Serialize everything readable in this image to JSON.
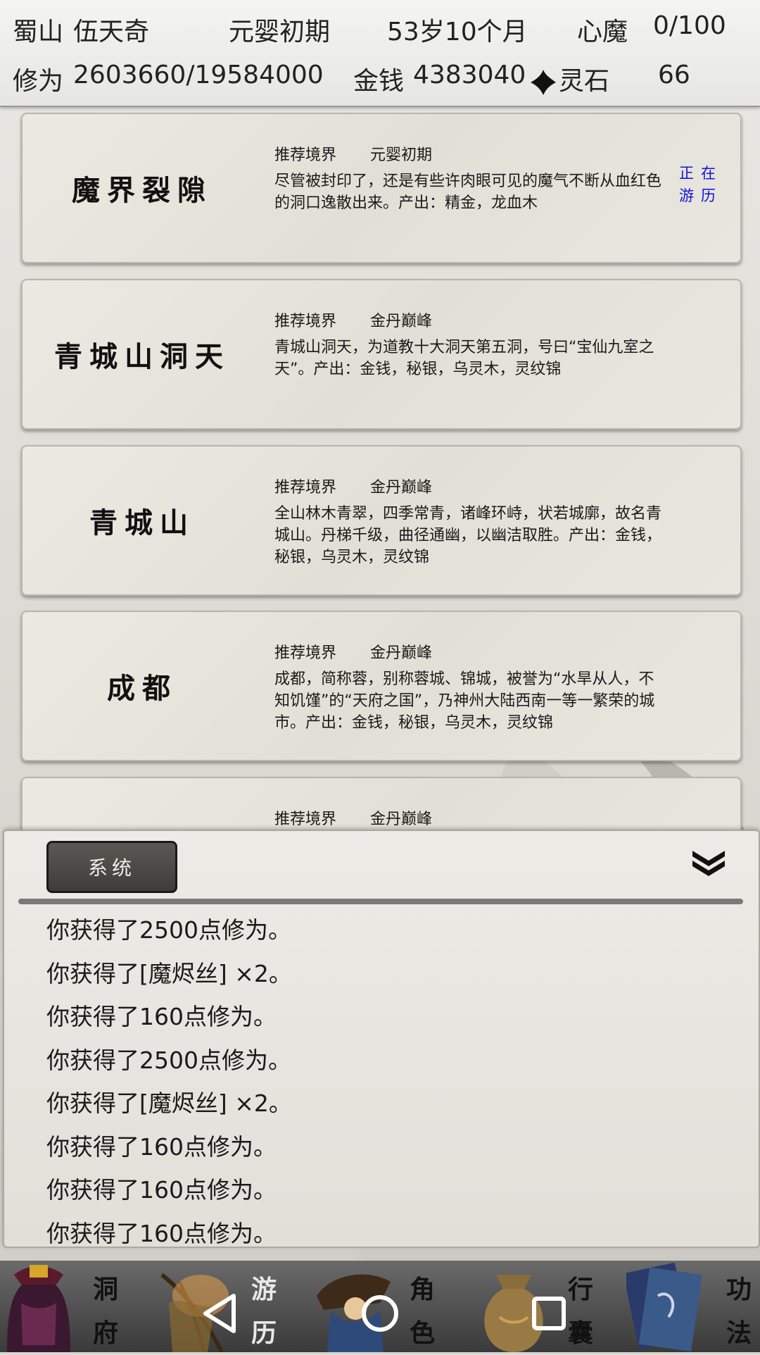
{
  "header": {
    "location": "蜀山",
    "character_name": "伍天奇",
    "realm": "元婴初期",
    "age": "53岁10个月",
    "demon_label": "心魔",
    "demon_value": "0/100",
    "cultivation_label": "修为",
    "cultivation_value": "2603660/19584000",
    "money_label": "金钱",
    "money_value": "4383040",
    "spirit_stone_label": "灵石",
    "spirit_stone_value": "66"
  },
  "locations": [
    {
      "name": "魔界裂隙",
      "realm_label": "推荐境界",
      "realm_value": "元婴初期",
      "description": "尽管被封印了，还是有些许肉眼可见的魔气不断从血红色的洞口逸散出来。产出：精金，龙血木",
      "status": "正在游历"
    },
    {
      "name": "青城山洞天",
      "realm_label": "推荐境界",
      "realm_value": "金丹巅峰",
      "description": "青城山洞天，为道教十大洞天第五洞，号曰“宝仙九室之天”。产出：金钱，秘银，乌灵木，灵纹锦"
    },
    {
      "name": "青城山",
      "realm_label": "推荐境界",
      "realm_value": "金丹巅峰",
      "description": "全山林木青翠，四季常青，诸峰环峙，状若城廓，故名青城山。丹梯千级，曲径通幽，以幽洁取胜。产出：金钱，秘银，乌灵木，灵纹锦"
    },
    {
      "name": "成都",
      "realm_label": "推荐境界",
      "realm_value": "金丹巅峰",
      "description": "成都，简称蓉，别称蓉城、锦城，被誉为“水旱从人，不知饥馑”的“天府之国”，乃神州大陆西南一等一繁荣的城市。产出：金钱，秘银，乌灵木，灵纹锦"
    },
    {
      "name": "",
      "realm_label": "推荐境界",
      "realm_value": "金丹巅峰",
      "description": ""
    }
  ],
  "log_panel": {
    "tab_label": "系统",
    "messages": [
      "你获得了2500点修为。",
      "你获得了[魔烬丝] ×2。",
      "你获得了160点修为。",
      "你获得了2500点修为。",
      "你获得了[魔烬丝] ×2。",
      "你获得了160点修为。",
      "你获得了160点修为。",
      "你获得了160点修为。"
    ]
  },
  "nav": {
    "items": [
      {
        "label_1": "洞",
        "label_2": "府",
        "icon": "palace-icon"
      },
      {
        "label_1": "游",
        "label_2": "历",
        "icon": "travel-icon",
        "active": true
      },
      {
        "label_1": "角",
        "label_2": "色",
        "icon": "character-icon"
      },
      {
        "label_1": "行",
        "label_2": "囊",
        "icon": "bag-icon"
      },
      {
        "label_1": "功",
        "label_2": "法",
        "icon": "book-icon"
      }
    ]
  },
  "colors": {
    "status_blue": "#1010e0",
    "tab_dark": "#4a4845"
  }
}
